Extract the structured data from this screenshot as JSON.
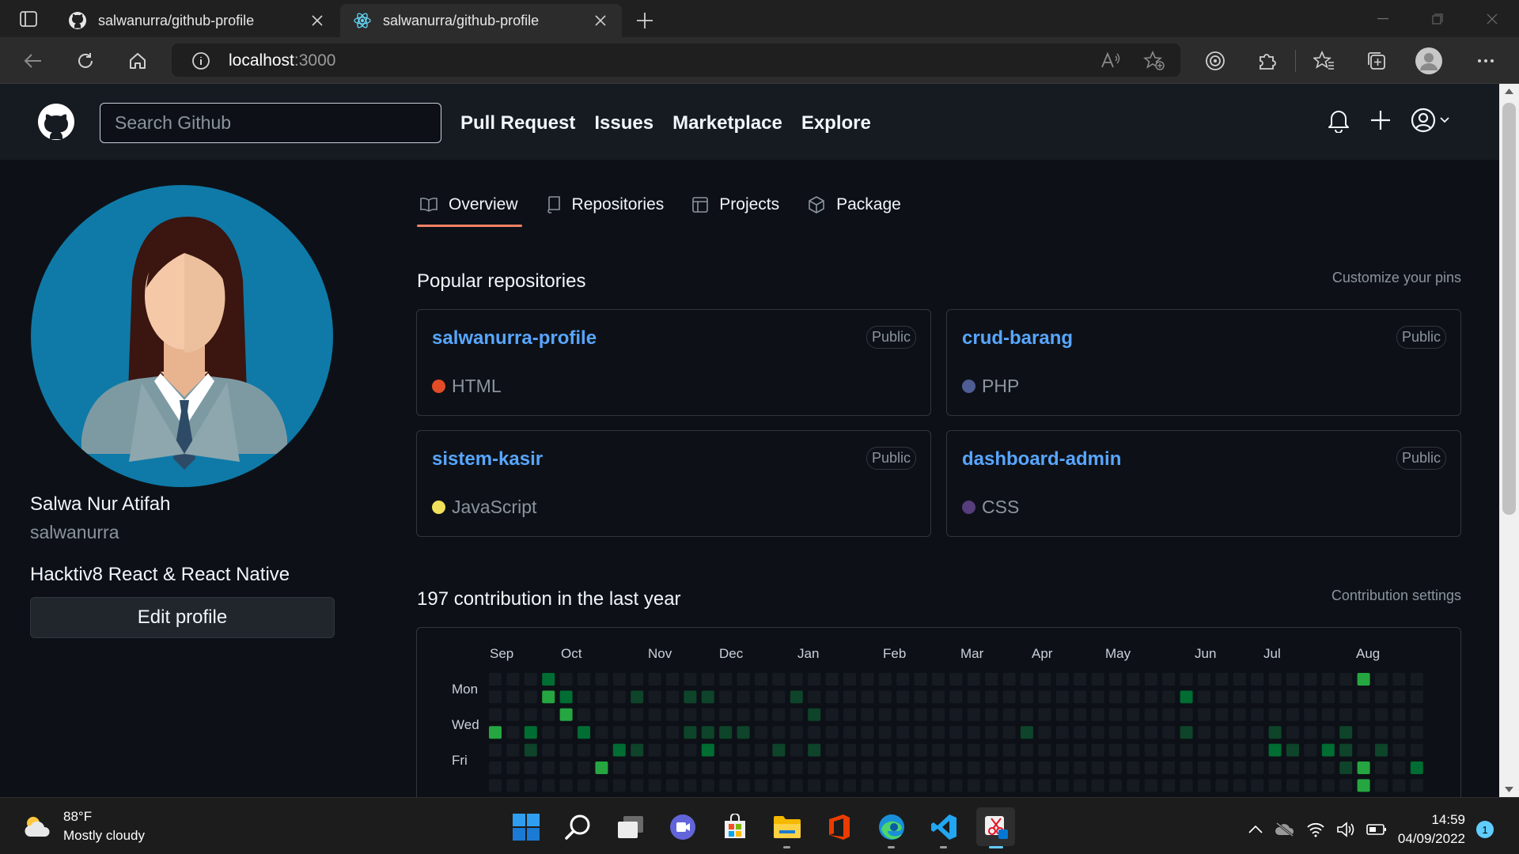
{
  "browser": {
    "tabs": [
      {
        "title": "salwanurra/github-profile",
        "icon": "github-icon"
      },
      {
        "title": "salwanurra/github-profile",
        "icon": "react-icon"
      }
    ],
    "address": {
      "host": "localhost",
      "port": ":3000"
    }
  },
  "header": {
    "search_placeholder": "Search Github",
    "nav": [
      "Pull Request",
      "Issues",
      "Marketplace",
      "Explore"
    ]
  },
  "profile": {
    "name": "Salwa Nur Atifah",
    "username": "salwanurra",
    "bio": "Hacktiv8 React & React Native",
    "edit_button": "Edit profile"
  },
  "tabs": [
    {
      "label": "Overview",
      "icon": "book-icon"
    },
    {
      "label": "Repositories",
      "icon": "repo-icon"
    },
    {
      "label": "Projects",
      "icon": "table-icon"
    },
    {
      "label": "Package",
      "icon": "package-icon"
    }
  ],
  "popular": {
    "title": "Popular repositories",
    "link": "Customize your pins",
    "repos": [
      {
        "name": "salwanurra-profile",
        "visibility": "Public",
        "language": "HTML",
        "color": "#e34c26"
      },
      {
        "name": "crud-barang",
        "visibility": "Public",
        "language": "PHP",
        "color": "#4F5D95"
      },
      {
        "name": "sistem-kasir",
        "visibility": "Public",
        "language": "JavaScript",
        "color": "#f1e05a"
      },
      {
        "name": "dashboard-admin",
        "visibility": "Public",
        "language": "CSS",
        "color": "#563d7c"
      }
    ]
  },
  "contributions": {
    "title": "197 contribution in the last year",
    "link": "Contribution settings",
    "months": [
      "Sep",
      "Oct",
      "Nov",
      "Dec",
      "Jan",
      "Feb",
      "Mar",
      "Apr",
      "May",
      "Jun",
      "Jul",
      "Aug"
    ],
    "days": [
      "Mon",
      "Wed",
      "Fri"
    ]
  },
  "taskbar": {
    "weather_temp": "88°F",
    "weather_desc": "Mostly cloudy",
    "time": "14:59",
    "date": "04/09/2022",
    "notifications": "1"
  }
}
